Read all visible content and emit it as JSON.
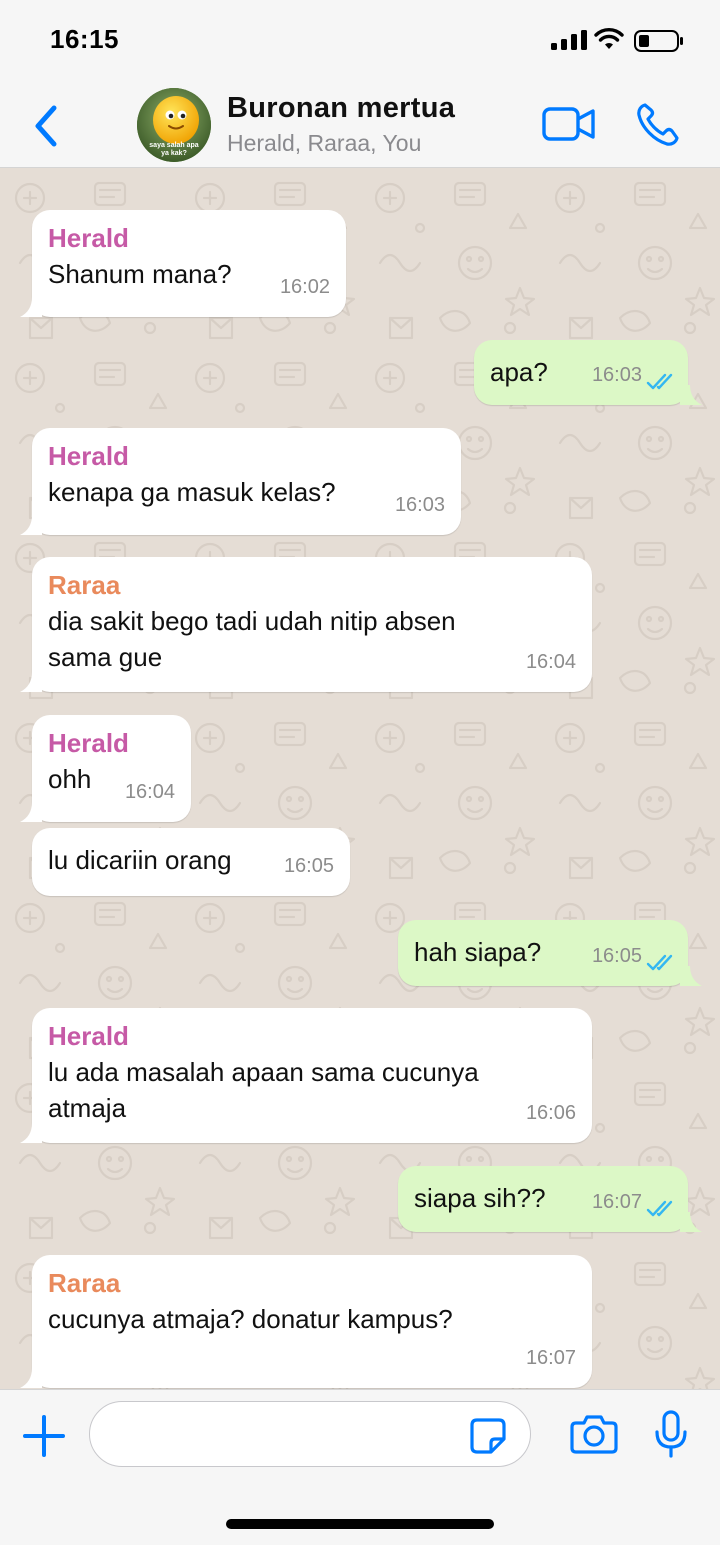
{
  "status_bar": {
    "time": "16:15"
  },
  "header": {
    "title": "Buronan mertua",
    "subtitle": "Herald, Raraa, You",
    "avatar_caption": "saya salah apa ya kak?"
  },
  "colors": {
    "accent": "#007aff",
    "herald": "#c65aa6",
    "raraa": "#e98a5c",
    "incoming_bubble": "#ffffff",
    "outgoing_bubble": "#dcf8c6",
    "read_ticks": "#34b7f1"
  },
  "messages": [
    {
      "direction": "in",
      "sender": "Herald",
      "lines": [
        "Shanum mana?"
      ],
      "time": "16:02"
    },
    {
      "direction": "out",
      "lines": [
        "apa?"
      ],
      "time": "16:03",
      "read": true
    },
    {
      "direction": "in",
      "sender": "Herald",
      "lines": [
        "kenapa ga masuk kelas?"
      ],
      "time": "16:03"
    },
    {
      "direction": "in",
      "sender": "Raraa",
      "lines": [
        "dia sakit bego tadi udah nitip absen",
        "sama gue"
      ],
      "time": "16:04"
    },
    {
      "direction": "in",
      "sender": "Herald",
      "lines": [
        "ohh"
      ],
      "time": "16:04"
    },
    {
      "direction": "in",
      "lines": [
        "lu dicariin orang"
      ],
      "time": "16:05"
    },
    {
      "direction": "out",
      "lines": [
        "hah siapa?"
      ],
      "time": "16:05",
      "read": true
    },
    {
      "direction": "in",
      "sender": "Herald",
      "lines": [
        "lu ada masalah apaan sama cucunya",
        "atmaja"
      ],
      "time": "16:06"
    },
    {
      "direction": "out",
      "lines": [
        "siapa sih??"
      ],
      "time": "16:07",
      "read": true
    },
    {
      "direction": "in",
      "sender": "Raraa",
      "lines": [
        "cucunya atmaja? donatur kampus?"
      ],
      "time": "16:07"
    }
  ],
  "composer": {
    "value": "",
    "placeholder": ""
  },
  "icons": {
    "back": "chevron-left-icon",
    "video": "video-camera-icon",
    "call": "phone-icon",
    "plus": "plus-icon",
    "sticker": "sticker-icon",
    "camera": "camera-icon",
    "mic": "microphone-icon"
  }
}
